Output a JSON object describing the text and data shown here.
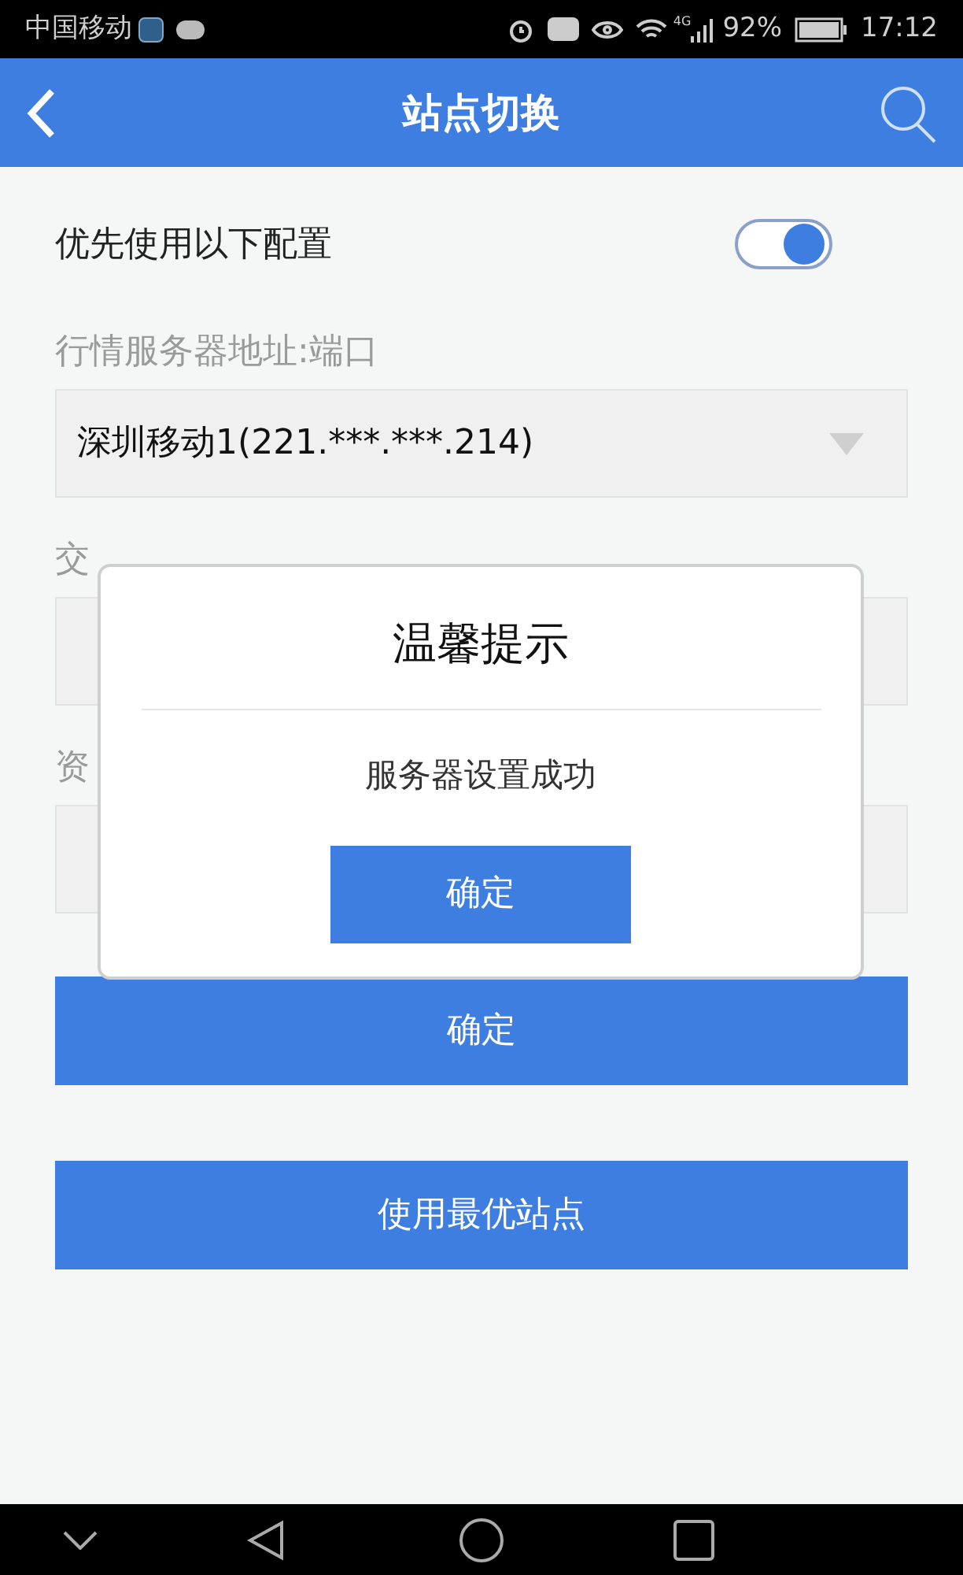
{
  "status_bar": {
    "carrier": "中国移动",
    "network": "4G",
    "battery": "92%",
    "time": "17:12"
  },
  "header": {
    "title": "站点切换"
  },
  "preference": {
    "label": "优先使用以下配置",
    "on": true
  },
  "fields": [
    {
      "label": "行情服务器地址:端口",
      "value": "深圳移动1(221.***.***.214)",
      "kind": "select"
    },
    {
      "label": "交",
      "kind": "select"
    },
    {
      "label": "资",
      "kind": "select"
    }
  ],
  "buttons": [
    "确定",
    "使用最优站点"
  ],
  "dialog": {
    "title": "温馨提示",
    "message": "服务器设置成功",
    "button": "确定"
  }
}
